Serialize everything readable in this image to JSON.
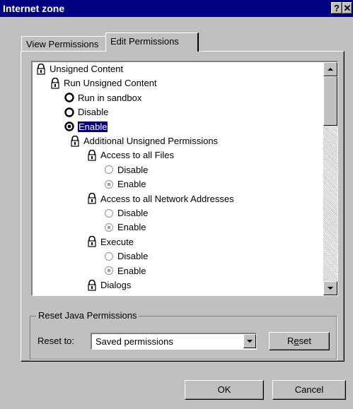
{
  "window": {
    "title": "Internet zone",
    "help_button": "?",
    "close_button": "✕"
  },
  "tabs": [
    {
      "label": "View Permissions",
      "active": false
    },
    {
      "label": "Edit Permissions",
      "active": true
    }
  ],
  "tree": [
    {
      "label": "Unsigned Content",
      "icon": "lock-icon",
      "depth": 0
    },
    {
      "label": "Run Unsigned Content",
      "icon": "lock-icon",
      "depth": 1
    },
    {
      "label": "Run in sandbox",
      "icon": "radio-icon",
      "depth": 2,
      "checked": false,
      "enabled": true
    },
    {
      "label": "Disable",
      "icon": "radio-icon",
      "depth": 2,
      "checked": false,
      "enabled": true
    },
    {
      "label": "Enable",
      "icon": "radio-icon",
      "depth": 2,
      "checked": true,
      "enabled": true,
      "selected": true
    },
    {
      "label": "Additional Unsigned Permissions",
      "icon": "lock-icon",
      "depth": 2
    },
    {
      "label": "Access to all Files",
      "icon": "lock-icon",
      "depth": 3
    },
    {
      "label": "Disable",
      "icon": "radio-icon",
      "depth": 4,
      "checked": false,
      "enabled": false
    },
    {
      "label": "Enable",
      "icon": "radio-icon",
      "depth": 4,
      "checked": true,
      "enabled": false
    },
    {
      "label": "Access to all Network Addresses",
      "icon": "lock-icon",
      "depth": 3
    },
    {
      "label": "Disable",
      "icon": "radio-icon",
      "depth": 4,
      "checked": false,
      "enabled": false
    },
    {
      "label": "Enable",
      "icon": "radio-icon",
      "depth": 4,
      "checked": true,
      "enabled": false
    },
    {
      "label": "Execute",
      "icon": "lock-icon",
      "depth": 3
    },
    {
      "label": "Disable",
      "icon": "radio-icon",
      "depth": 4,
      "checked": false,
      "enabled": false
    },
    {
      "label": "Enable",
      "icon": "radio-icon",
      "depth": 4,
      "checked": true,
      "enabled": false
    },
    {
      "label": "Dialogs",
      "icon": "lock-icon",
      "depth": 3
    }
  ],
  "reset_group": {
    "legend": "Reset Java Permissions",
    "reset_to_label": "Reset to:",
    "selected_option": "Saved permissions",
    "reset_button": "Reset"
  },
  "footer": {
    "ok_label": "OK",
    "cancel_label": "Cancel"
  },
  "colors": {
    "title_bar": "#000080",
    "face": "#c0c0c0",
    "selection": "#000080",
    "disabled_text": "#808080"
  }
}
